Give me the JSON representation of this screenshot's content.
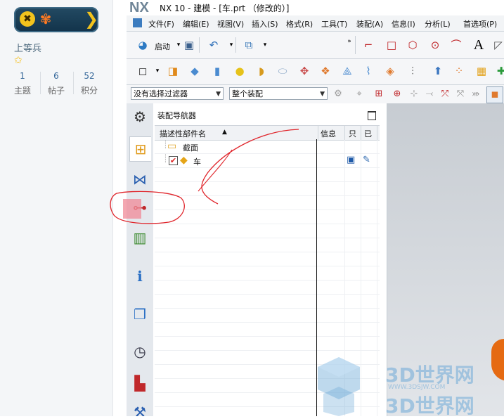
{
  "profile": {
    "rank": "上等兵",
    "stats": [
      {
        "num": "1",
        "label": "主题"
      },
      {
        "num": "6",
        "label": "帖子"
      },
      {
        "num": "52",
        "label": "积分"
      }
    ]
  },
  "nx": {
    "logo": "NX",
    "title": "NX 10 - 建模 - [车.prt （修改的）]",
    "menu": [
      "文件(F)",
      "编辑(E)",
      "视图(V)",
      "插入(S)",
      "格式(R)",
      "工具(T)",
      "装配(A)",
      "信息(I)",
      "分析(L)",
      "首选项(P)"
    ],
    "toolbar1": {
      "start_label": "启动"
    },
    "filters": {
      "selection_filter": "没有选择过滤器",
      "scope": "整个装配"
    },
    "navigator": {
      "title": "装配导航器",
      "columns": {
        "name": "描述性部件名",
        "info": "信息",
        "readonly": "只",
        "modified": "已"
      },
      "rows": [
        {
          "label": "截面"
        },
        {
          "label": "车"
        }
      ]
    },
    "watermark": {
      "text": "3D世界网",
      "url": "WWW.3DSJW.COM"
    }
  },
  "colors": {
    "annotation_red": "#e0252b",
    "highlight_fill": "#f08a97"
  }
}
